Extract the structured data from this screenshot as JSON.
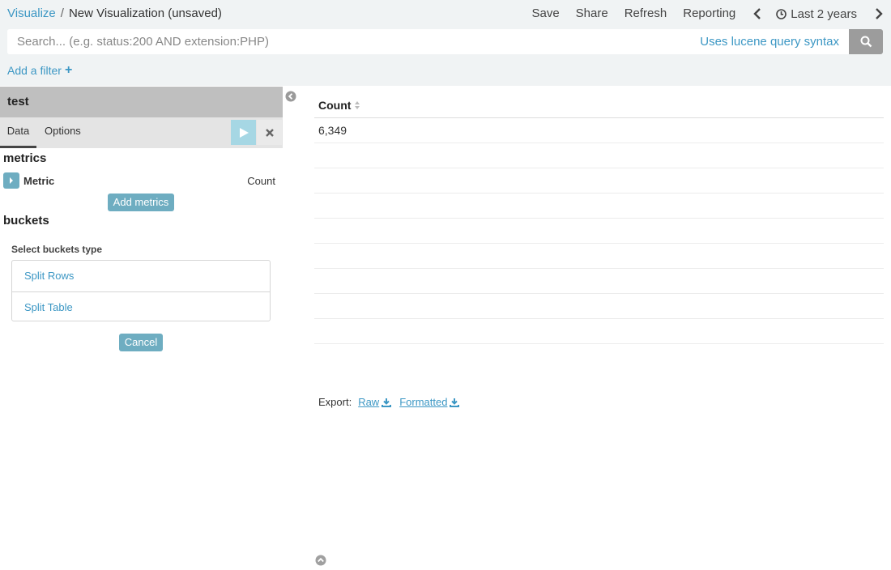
{
  "breadcrumb": {
    "root": "Visualize",
    "separator": "/",
    "current": "New Visualization (unsaved)"
  },
  "topmenu": {
    "save": "Save",
    "share": "Share",
    "refresh": "Refresh",
    "reporting": "Reporting",
    "time_range": "Last 2 years"
  },
  "search": {
    "placeholder": "Search... (e.g. status:200 AND extension:PHP)",
    "value": "",
    "syntax_link": "Uses lucene query syntax"
  },
  "filter": {
    "add_label": "Add a filter",
    "plus": "+"
  },
  "sidebar": {
    "title": "test",
    "tabs": [
      {
        "label": "Data"
      },
      {
        "label": "Options"
      }
    ],
    "metrics_heading": "metrics",
    "metric": {
      "label": "Metric",
      "value": "Count"
    },
    "add_metrics_label": "Add metrics",
    "buckets_heading": "buckets",
    "select_buckets_label": "Select buckets type",
    "bucket_types": [
      {
        "label": "Split Rows"
      },
      {
        "label": "Split Table"
      }
    ],
    "cancel_label": "Cancel"
  },
  "table": {
    "header": "Count",
    "rows": [
      "6,349",
      "",
      "",
      "",
      "",
      "",
      "",
      "",
      ""
    ]
  },
  "export": {
    "label": "Export:",
    "raw": "Raw",
    "formatted": "Formatted"
  },
  "colors": {
    "accent": "#3c97c4",
    "button": "#6eadc1",
    "apply": "#a6d7e4",
    "topbar_bg": "#f0f3f4",
    "title_bg": "#bfbfbf"
  },
  "icons": {
    "search": "search-icon",
    "clock": "clock-icon",
    "prev": "chevron-left-icon",
    "next": "chevron-right-icon",
    "apply": "play-icon",
    "discard": "close-icon",
    "collapse": "collapse-left-icon",
    "sort": "sort-icon",
    "download": "download-icon",
    "scroll_up": "chevron-up-circle-icon"
  }
}
